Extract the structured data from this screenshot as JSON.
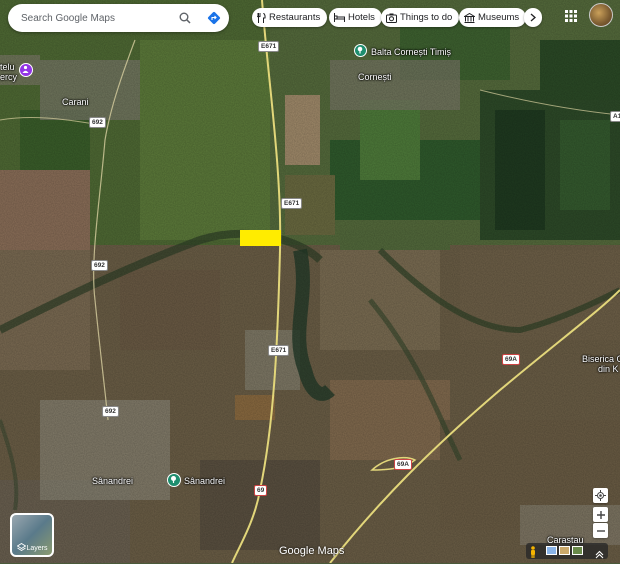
{
  "search": {
    "placeholder": "Search Google Maps"
  },
  "chips": [
    {
      "label": "Restaurants",
      "icon": "fork-knife-icon"
    },
    {
      "label": "Hotels",
      "icon": "bed-icon"
    },
    {
      "label": "Things to do",
      "icon": "camera-icon"
    },
    {
      "label": "Museums",
      "icon": "museum-icon"
    }
  ],
  "places": {
    "carani": "Carani",
    "cornesti": "Cornești",
    "balta": "Balta Cornești Timiș",
    "sanandrei_town": "Sânandrei",
    "sanandrei_poi": "Sânandrei",
    "partial_left_1": "telu",
    "partial_left_2": "ercy",
    "biserica_1": "Biserica O",
    "biserica_2": "din K",
    "carastau": "Carastau"
  },
  "roads": {
    "e671": "E671",
    "r692": "692",
    "r69a": "69A",
    "r69": "69",
    "a1": "A1"
  },
  "layers_label": "Layers",
  "attribution": "Google Maps",
  "colors": {
    "marker_highlight": "#ffec00",
    "poi_teal": "#1e8e6e",
    "poi_purple": "#9334e6"
  }
}
